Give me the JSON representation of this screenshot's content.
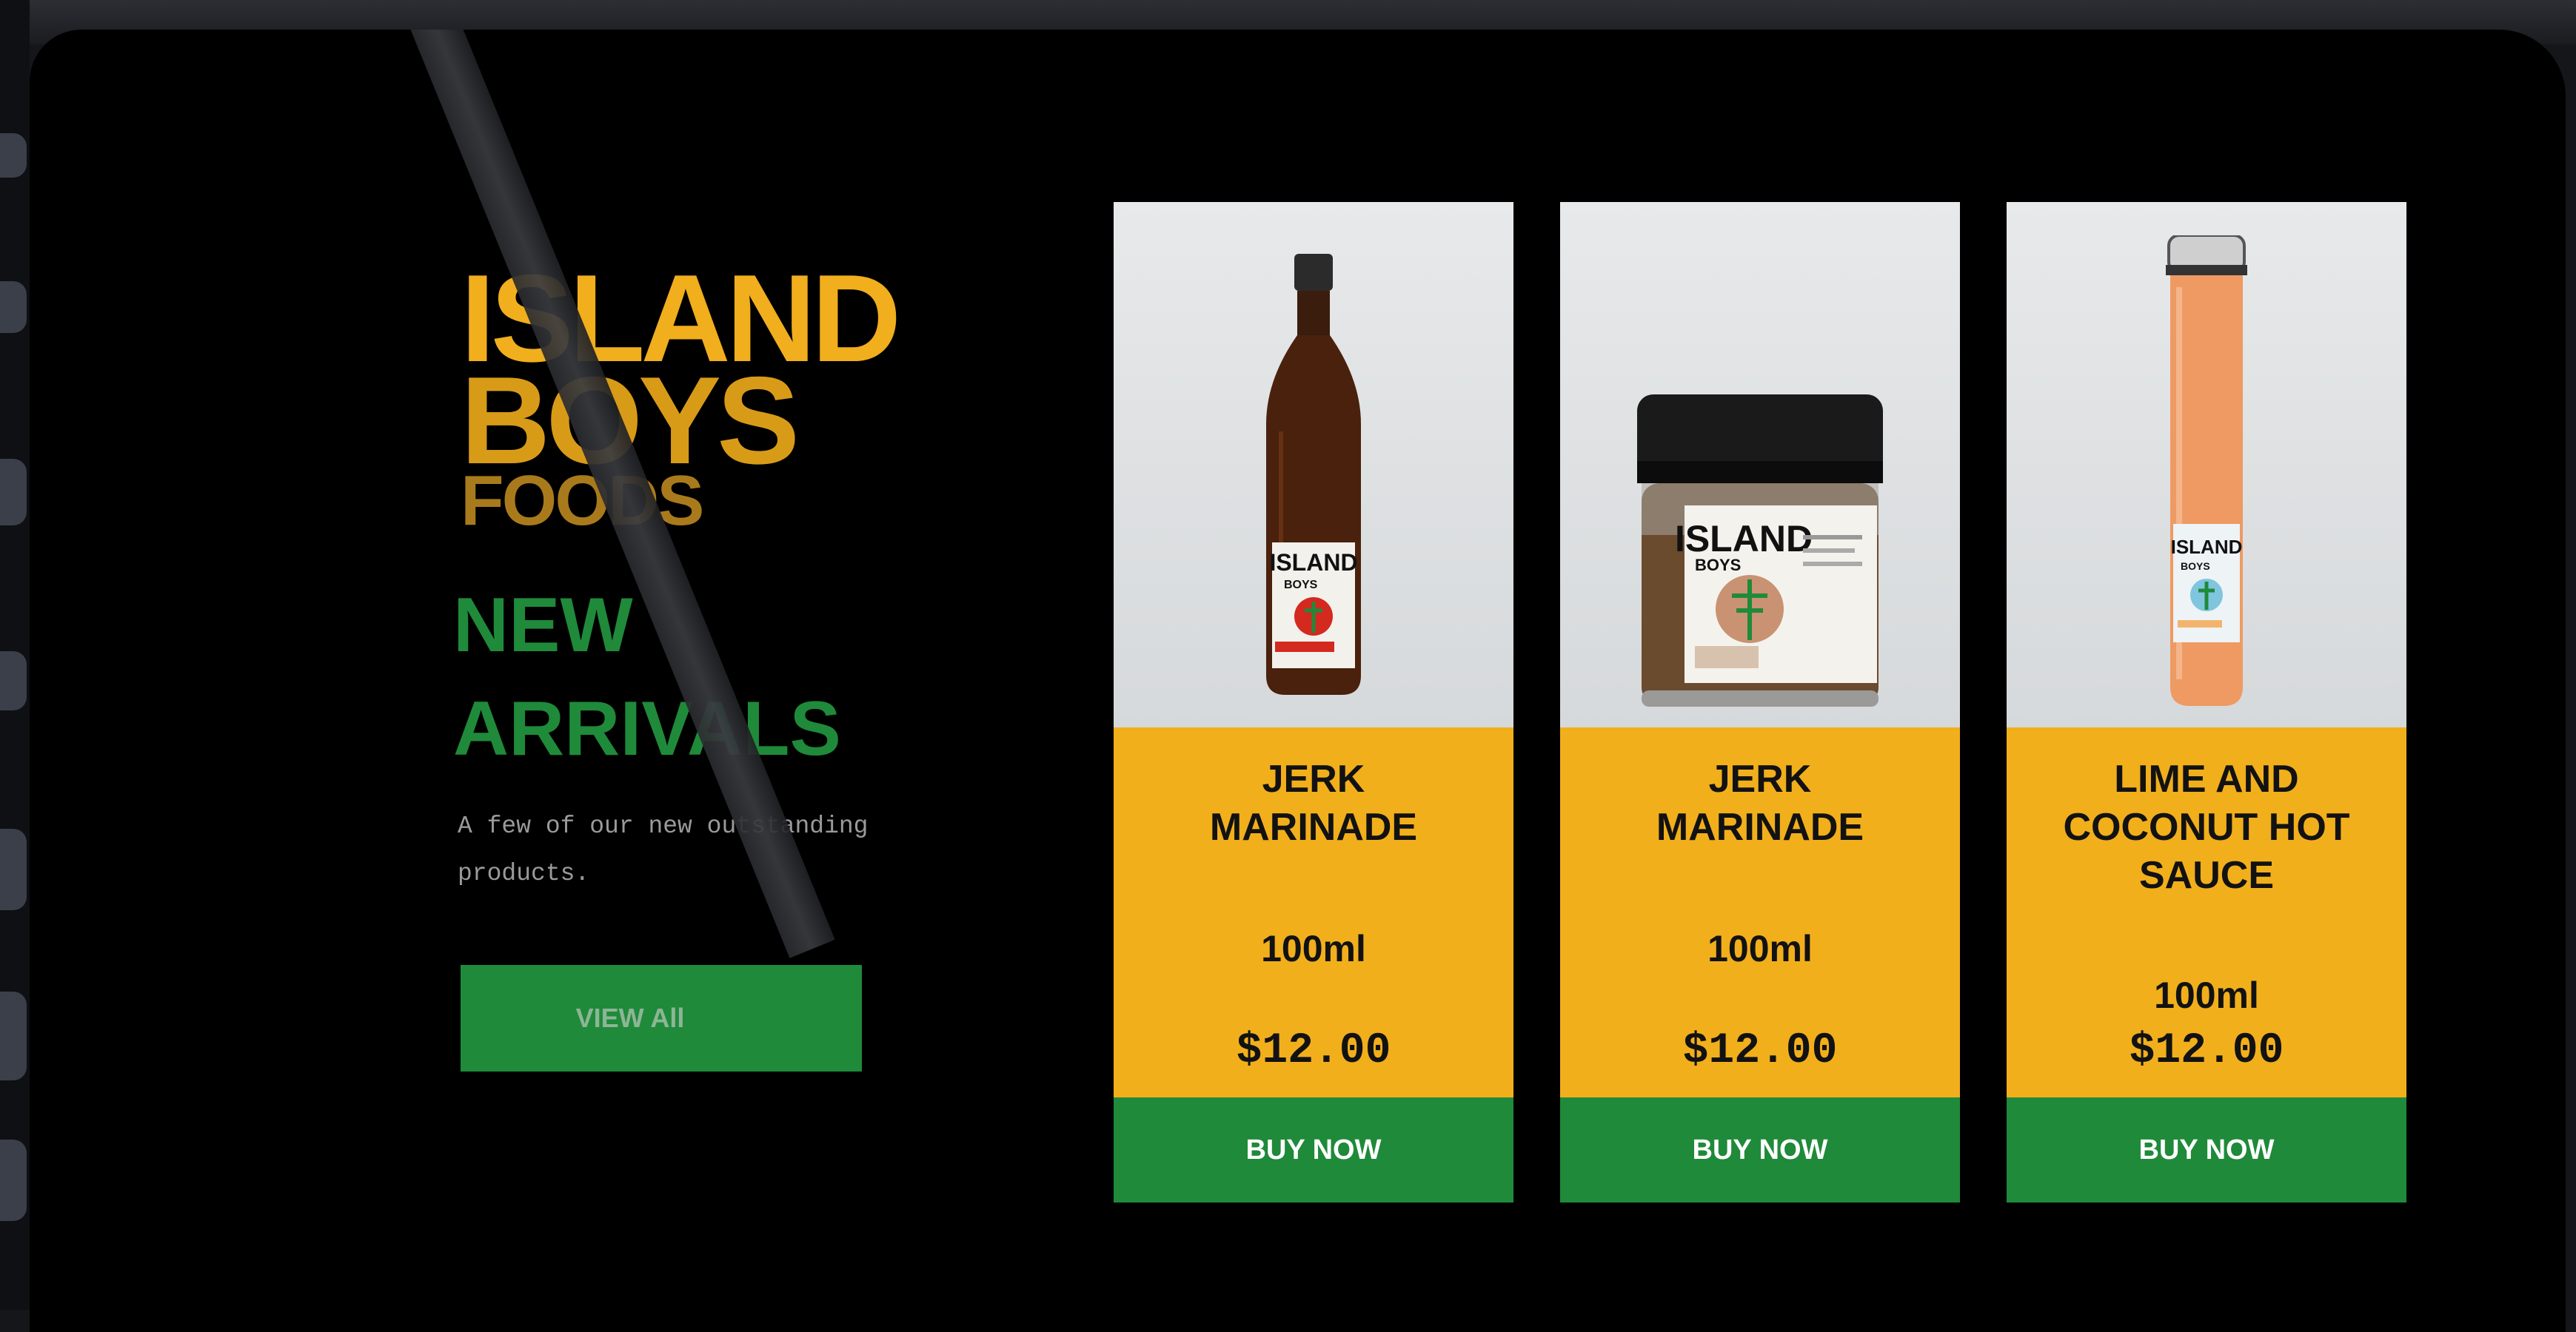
{
  "brand": {
    "logo_line1": "ISLAND",
    "logo_line2": "BOYS",
    "logo_line3": "FOODS",
    "label_text": "ISLAND",
    "label_sub": "BOYS"
  },
  "hero": {
    "headline_line1": "NEW",
    "headline_line2": "ARRIVALS",
    "subtext": "A few of our new outstanding products.",
    "view_all_label": "VIEW All"
  },
  "colors": {
    "background": "#000000",
    "brand_yellow": "#f2af1c",
    "brand_green": "#1f8a3a"
  },
  "products": [
    {
      "name": "JERK MARINADE",
      "size": "100ml",
      "price": "$12.00",
      "buy_label": "BUY NOW",
      "image": "amber-bottle"
    },
    {
      "name": "JERK MARINADE",
      "size": "100ml",
      "price": "$12.00",
      "buy_label": "BUY NOW",
      "image": "seasoning-jar"
    },
    {
      "name": "LIME AND COCONUT HOT SAUCE",
      "size": "100ml",
      "price": "$12.00",
      "buy_label": "BUY NOW",
      "image": "orange-bottle"
    }
  ]
}
